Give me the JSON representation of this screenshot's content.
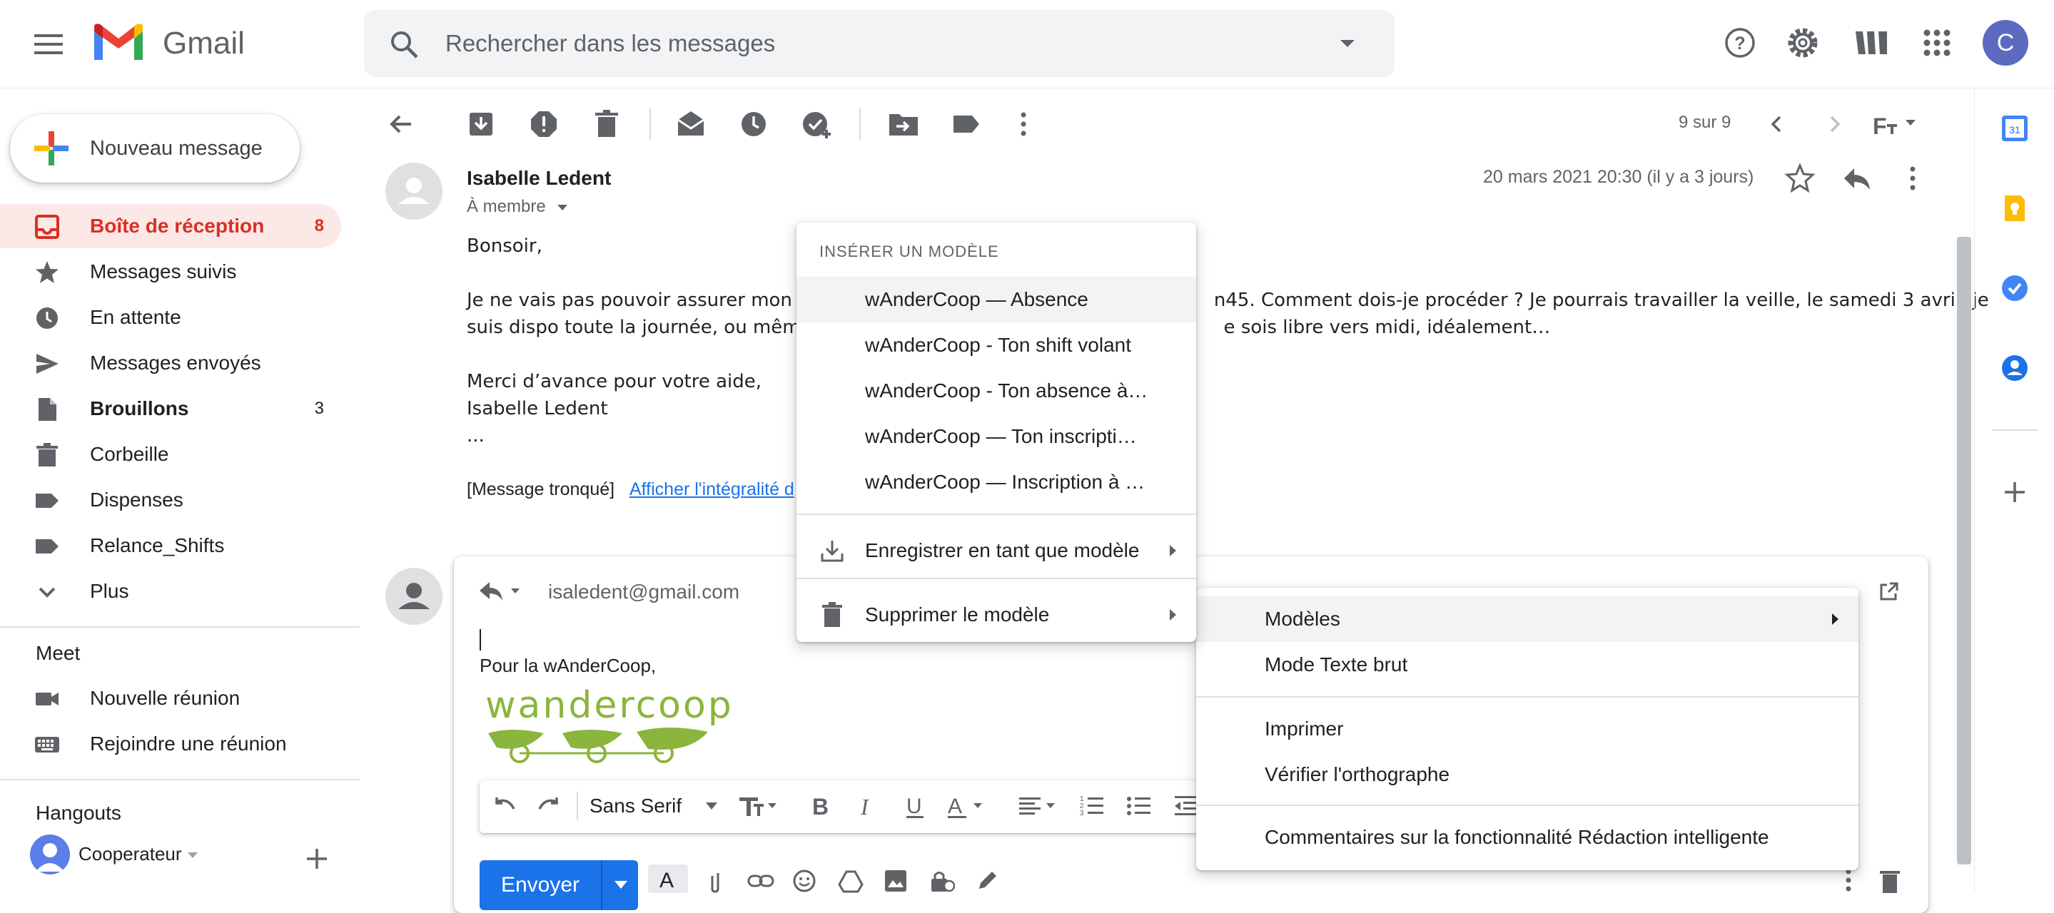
{
  "header": {
    "brand": "Gmail",
    "search_placeholder": "Rechercher dans les messages",
    "avatar_letter": "C"
  },
  "sidebar": {
    "compose_label": "Nouveau message",
    "items": [
      {
        "label": "Boîte de réception",
        "count": "8",
        "icon": "inbox-icon"
      },
      {
        "label": "Messages suivis",
        "count": "",
        "icon": "star-icon"
      },
      {
        "label": "En attente",
        "count": "",
        "icon": "clock-icon"
      },
      {
        "label": "Messages envoyés",
        "count": "",
        "icon": "send-icon"
      },
      {
        "label": "Brouillons",
        "count": "3",
        "icon": "draft-icon"
      },
      {
        "label": "Corbeille",
        "count": "",
        "icon": "trash-icon"
      },
      {
        "label": "Dispenses",
        "count": "",
        "icon": "label-icon"
      },
      {
        "label": "Relance_Shifts",
        "count": "",
        "icon": "label-icon"
      },
      {
        "label": "Plus",
        "count": "",
        "icon": "chevron-down-icon"
      }
    ],
    "meet_title": "Meet",
    "meet_items": [
      "Nouvelle réunion",
      "Rejoindre une réunion"
    ],
    "hangouts_title": "Hangouts",
    "hangouts_user": "Cooperateur"
  },
  "toolbar": {
    "pager": "9 sur 9"
  },
  "message": {
    "sender": "Isabelle Ledent",
    "to": "À membre",
    "date": "20 mars 2021 20:30 (il y a 3 jours)",
    "body_lines": [
      "Bonsoir,",
      "",
      "Je ne vais pas pouvoir assurer mon shi                                                                  n45. Comment dois-je procéder ? Je pourrais travailler la veille, le samedi 3 avril, je",
      "suis dispo toute la journée, ou même le                                                                  e sois libre vers midi, idéalement…",
      "",
      "Merci d’avance pour votre aide,",
      "Isabelle Ledent",
      "..."
    ],
    "truncated": "[Message tronqué]",
    "truncated_link": "Afficher l'intégralité d"
  },
  "reply": {
    "to": "isaledent@gmail.com",
    "signature": "Pour la wAnderCoop,",
    "logo_text": "wandercoop",
    "font": "Sans Serif",
    "send_label": "Envoyer"
  },
  "template_menu": {
    "heading": "INSÉRER UN MODÈLE",
    "templates": [
      "wAnderCoop — Absence",
      "wAnderCoop - Ton shift volant",
      "wAnderCoop - Ton absence à…",
      "wAnderCoop — Ton inscripti…",
      "wAnderCoop — Inscription à …"
    ],
    "save_label": "Enregistrer en tant que modèle",
    "delete_label": "Supprimer le modèle"
  },
  "more_menu": {
    "items": [
      "Modèles",
      "Mode Texte brut",
      "Imprimer",
      "Vérifier l'orthographe",
      "Commentaires sur la fonctionnalité Rédaction intelligente"
    ]
  },
  "colors": {
    "accent_red": "#d93025",
    "send_blue": "#1a73e8",
    "avatar": "#5c6bc0",
    "logo_green": "#8bb53d"
  }
}
